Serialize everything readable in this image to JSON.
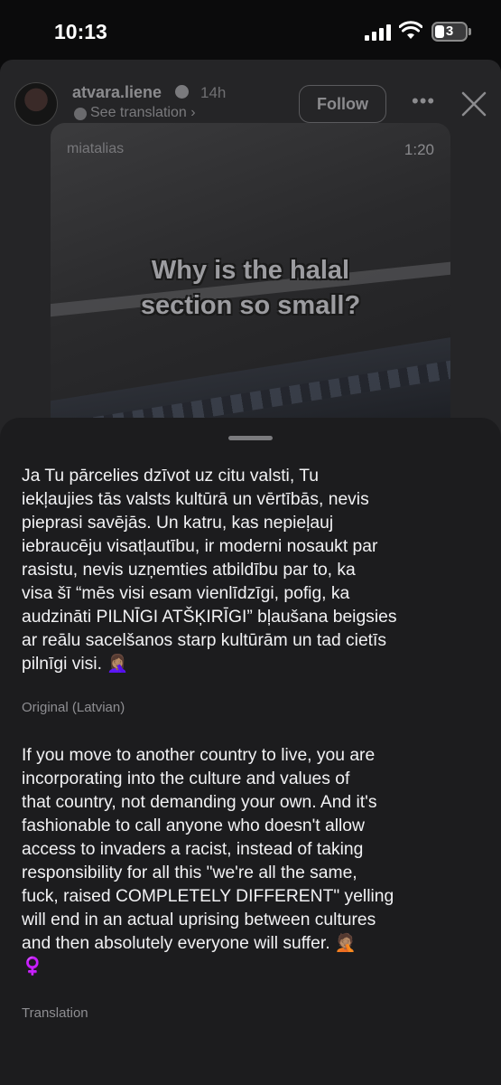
{
  "status_bar": {
    "time": "10:13",
    "battery_level": "3"
  },
  "post": {
    "username": "atvara.liene",
    "time_ago": "14h",
    "see_translation": "See translation",
    "follow_label": "Follow",
    "video": {
      "source": "miatalias",
      "duration": "1:20",
      "caption_line1": "Why is the halal",
      "caption_line2": "section so small?"
    }
  },
  "sheet": {
    "original_text": "Ja Tu pārcelies dzīvot uz citu valsti, Tu\niekļaujies tās valsts kultūrā un vērtībās, nevis\npieprasi savējās. Un katru, kas nepieļauj\niebraucēju visatļautību, ir moderni nosaukt par\nrasistu, nevis uzņemties atbildību par to, ka\nvisa šī “mēs visi esam vienlīdzīgi, pofig, ka\naudzināti PILNĪGI ATŠĶIRĪGI” bļaušana beigsies\nar reālu sacelšanos starp kultūrām un tad cietīs\npilnīgi visi. 🤦🏽‍♀️",
    "original_label": "Original (Latvian)",
    "translated_text": "If you move to another country to live, you are\nincorporating into the culture and values of\nthat country, not demanding your own. And it's\nfashionable to call anyone who doesn't allow\naccess to invaders a racist, instead of taking\nresponsibility for all this \"we're all the same,\nfuck, raised COMPLETELY DIFFERENT\" yelling\nwill end in an actual uprising between cultures\nand then absolutely everyone will suffer. 🤦🏽\n♀️",
    "translation_label": "Translation"
  }
}
